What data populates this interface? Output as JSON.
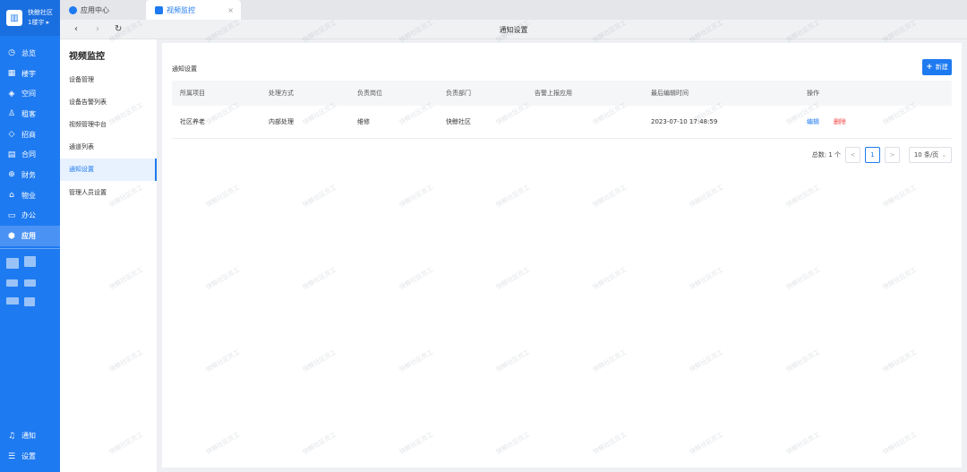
{
  "brand": {
    "name": "快鲸社区",
    "sub": "1楼宇 ▸"
  },
  "nav": [
    {
      "label": "总览",
      "icon": "clock-icon"
    },
    {
      "label": "楼宇",
      "icon": "building-icon"
    },
    {
      "label": "空间",
      "icon": "cube-icon"
    },
    {
      "label": "租客",
      "icon": "person-icon"
    },
    {
      "label": "招商",
      "icon": "tag-icon"
    },
    {
      "label": "合同",
      "icon": "document-icon"
    },
    {
      "label": "财务",
      "icon": "finance-icon"
    },
    {
      "label": "物业",
      "icon": "home-icon"
    },
    {
      "label": "办公",
      "icon": "monitor-icon"
    },
    {
      "label": "应用",
      "icon": "apps-icon",
      "active": true
    }
  ],
  "bottom_nav": [
    {
      "label": "通知",
      "icon": "bell-icon"
    },
    {
      "label": "设置",
      "icon": "menu-icon"
    }
  ],
  "tabs": [
    {
      "label": "应用中心",
      "icon": "app-center-icon"
    },
    {
      "label": "视频监控",
      "icon": "video-icon",
      "close": "×"
    }
  ],
  "addressbar": {
    "back": "‹",
    "forward": "›",
    "refresh": "↻",
    "title": "通知设置"
  },
  "submenu": {
    "title": "视频监控",
    "items": [
      {
        "label": "设备管理"
      },
      {
        "label": "设备告警列表"
      },
      {
        "label": "视频管理中台"
      },
      {
        "label": "通道列表"
      },
      {
        "label": "通知设置",
        "active": true
      },
      {
        "label": "管理人员设置"
      }
    ]
  },
  "main": {
    "title": "通知设置",
    "new_button": "新建",
    "columns": [
      "所属项目",
      "处理方式",
      "负责岗位",
      "负责部门",
      "告警上报应用",
      "最后编辑时间",
      "操作"
    ],
    "rows": [
      {
        "project": "社区养老",
        "method": "内部处理",
        "position": "维修",
        "dept": "快鲸社区",
        "app": "",
        "time": "2023-07-10 17:48:59",
        "edit": "编辑",
        "delete": "删除"
      }
    ],
    "pager": {
      "total": "总数: 1 个",
      "prev": "<",
      "page": "1",
      "next": ">",
      "size": "10 条/页",
      "size_caret": "⌄"
    }
  },
  "watermark": "快鲸社区员工",
  "colors": {
    "primary": "#1e7af0",
    "danger": "#f04040",
    "sidebar": "#1e7af0"
  }
}
